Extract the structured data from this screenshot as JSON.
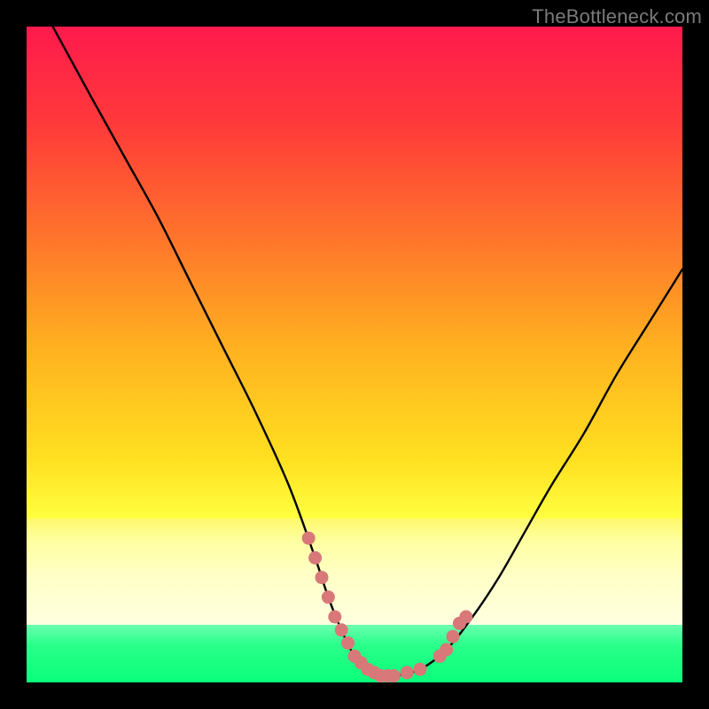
{
  "watermark": "TheBottleneck.com",
  "chart_data": {
    "type": "line",
    "title": "",
    "xlabel": "",
    "ylabel": "",
    "xlim": [
      0,
      100
    ],
    "ylim": [
      0,
      100
    ],
    "series": [
      {
        "name": "bottleneck-curve",
        "x": [
          4,
          10,
          15,
          20,
          25,
          30,
          35,
          40,
          44,
          46,
          48,
          50,
          52,
          54,
          56,
          60,
          64,
          68,
          72,
          76,
          80,
          85,
          90,
          95,
          100
        ],
        "values": [
          100,
          89,
          80,
          71,
          61,
          51,
          41,
          30,
          19,
          13,
          8,
          4,
          2,
          1,
          1,
          2,
          5,
          10,
          16,
          23,
          30,
          38,
          47,
          55,
          63
        ]
      }
    ],
    "markers": {
      "name": "highlight-dots",
      "color": "#d87878",
      "x": [
        43,
        44,
        45,
        46,
        47,
        48,
        49,
        50,
        51,
        52,
        53,
        54,
        55,
        56,
        58,
        60,
        63,
        64,
        65,
        66,
        67
      ],
      "values": [
        22,
        19,
        16,
        13,
        10,
        8,
        6,
        4,
        3,
        2,
        1.5,
        1,
        1,
        1,
        1.5,
        2,
        4,
        5,
        7,
        9,
        10
      ]
    },
    "bands": [
      {
        "name": "gradient-top",
        "y_from": 25,
        "y_to": 100
      },
      {
        "name": "cream",
        "y_from": 8.8,
        "y_to": 25
      },
      {
        "name": "green",
        "y_from": 0,
        "y_to": 8.8
      }
    ]
  }
}
